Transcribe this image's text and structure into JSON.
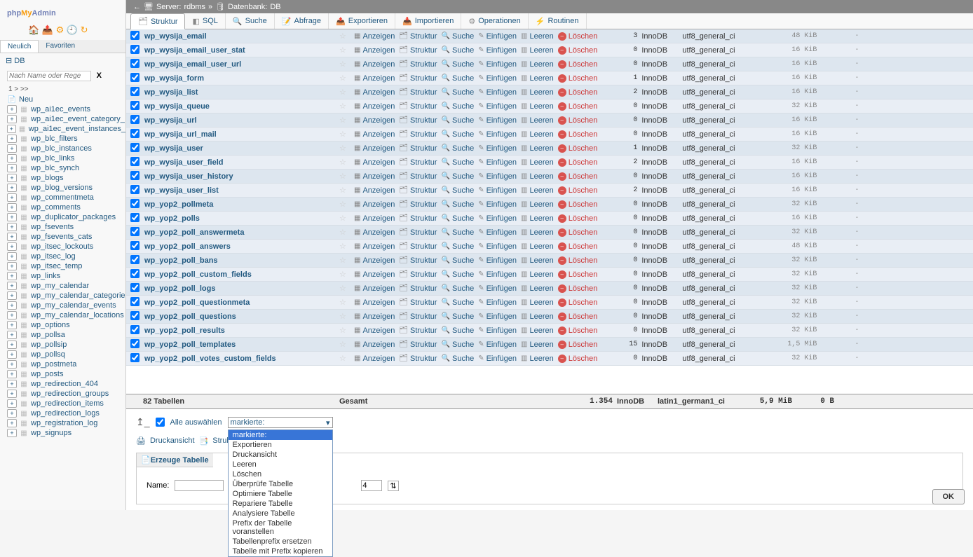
{
  "logo": {
    "php": "php",
    "my": "My",
    "admin": "Admin"
  },
  "sidebar_tabs": {
    "recent": "Neulich",
    "fav": "Favoriten"
  },
  "db_label": "DB",
  "filter_placeholder": "Nach Name oder Regex filtern",
  "paging": "1   > >>",
  "neu_label": "Neu",
  "tree": [
    "wp_ai1ec_events",
    "wp_ai1ec_event_category_",
    "wp_ai1ec_event_instances_",
    "wp_blc_filters",
    "wp_blc_instances",
    "wp_blc_links",
    "wp_blc_synch",
    "wp_blogs",
    "wp_blog_versions",
    "wp_commentmeta",
    "wp_comments",
    "wp_duplicator_packages",
    "wp_fsevents",
    "wp_fsevents_cats",
    "wp_itsec_lockouts",
    "wp_itsec_log",
    "wp_itsec_temp",
    "wp_links",
    "wp_my_calendar",
    "wp_my_calendar_categorie",
    "wp_my_calendar_events",
    "wp_my_calendar_locations",
    "wp_options",
    "wp_pollsa",
    "wp_pollsip",
    "wp_pollsq",
    "wp_postmeta",
    "wp_posts",
    "wp_redirection_404",
    "wp_redirection_groups",
    "wp_redirection_items",
    "wp_redirection_logs",
    "wp_registration_log",
    "wp_signups"
  ],
  "breadcrumb": {
    "server_label": "Server:",
    "server": "rdbms",
    "db_label": "Datenbank:",
    "db": "DB"
  },
  "tabs": [
    {
      "icon": "🗂",
      "label": "Struktur",
      "active": true
    },
    {
      "icon": "◧",
      "label": "SQL"
    },
    {
      "icon": "🔍",
      "label": "Suche"
    },
    {
      "icon": "📝",
      "label": "Abfrage"
    },
    {
      "icon": "📤",
      "label": "Exportieren"
    },
    {
      "icon": "📥",
      "label": "Importieren"
    },
    {
      "icon": "⚙",
      "label": "Operationen"
    },
    {
      "icon": "⚡",
      "label": "Routinen"
    }
  ],
  "row_actions": {
    "browse": "Anzeigen",
    "structure": "Struktur",
    "search": "Suche",
    "insert": "Einfügen",
    "empty": "Leeren",
    "drop": "Löschen"
  },
  "cols": {
    "engine": "InnoDB",
    "collation": "utf8_general_ci"
  },
  "tables": [
    {
      "name": "wp_wysija_email",
      "rows": 3,
      "size": "48 KiB"
    },
    {
      "name": "wp_wysija_email_user_stat",
      "rows": 0,
      "size": "16 KiB"
    },
    {
      "name": "wp_wysija_email_user_url",
      "rows": 0,
      "size": "16 KiB"
    },
    {
      "name": "wp_wysija_form",
      "rows": 1,
      "size": "16 KiB"
    },
    {
      "name": "wp_wysija_list",
      "rows": 2,
      "size": "16 KiB"
    },
    {
      "name": "wp_wysija_queue",
      "rows": 0,
      "size": "32 KiB"
    },
    {
      "name": "wp_wysija_url",
      "rows": 0,
      "size": "16 KiB"
    },
    {
      "name": "wp_wysija_url_mail",
      "rows": 0,
      "size": "16 KiB"
    },
    {
      "name": "wp_wysija_user",
      "rows": 1,
      "size": "32 KiB"
    },
    {
      "name": "wp_wysija_user_field",
      "rows": 2,
      "size": "16 KiB"
    },
    {
      "name": "wp_wysija_user_history",
      "rows": 0,
      "size": "16 KiB"
    },
    {
      "name": "wp_wysija_user_list",
      "rows": 2,
      "size": "16 KiB"
    },
    {
      "name": "wp_yop2_pollmeta",
      "rows": 0,
      "size": "32 KiB"
    },
    {
      "name": "wp_yop2_polls",
      "rows": 0,
      "size": "16 KiB"
    },
    {
      "name": "wp_yop2_poll_answermeta",
      "rows": 0,
      "size": "32 KiB"
    },
    {
      "name": "wp_yop2_poll_answers",
      "rows": 0,
      "size": "48 KiB"
    },
    {
      "name": "wp_yop2_poll_bans",
      "rows": 0,
      "size": "32 KiB"
    },
    {
      "name": "wp_yop2_poll_custom_fields",
      "rows": 0,
      "size": "32 KiB"
    },
    {
      "name": "wp_yop2_poll_logs",
      "rows": 0,
      "size": "32 KiB"
    },
    {
      "name": "wp_yop2_poll_questionmeta",
      "rows": 0,
      "size": "32 KiB"
    },
    {
      "name": "wp_yop2_poll_questions",
      "rows": 0,
      "size": "32 KiB"
    },
    {
      "name": "wp_yop2_poll_results",
      "rows": 0,
      "size": "32 KiB"
    },
    {
      "name": "wp_yop2_poll_templates",
      "rows": 15,
      "size": "1,5 MiB"
    },
    {
      "name": "wp_yop2_poll_votes_custom_fields",
      "rows": 0,
      "size": "32 KiB"
    }
  ],
  "summary": {
    "count": "82 Tabellen",
    "total_label": "Gesamt",
    "rows": "1.354",
    "engine": "InnoDB",
    "collation": "latin1_german1_ci",
    "size": "5,9 MiB",
    "overhead": "0 B"
  },
  "checkall": {
    "label": "Alle auswählen",
    "selected": "markierte:"
  },
  "dropdown_options": [
    "markierte:",
    "Exportieren",
    "Druckansicht",
    "Leeren",
    "Löschen",
    "Überprüfe Tabelle",
    "Optimiere Tabelle",
    "Repariere Tabelle",
    "Analysiere Tabelle",
    "Prefix der Tabelle voranstellen",
    "Tabellenprefix ersetzen",
    "Tabelle mit Prefix kopieren"
  ],
  "printline": {
    "print": "Druckansicht",
    "dict": "Strukturverz"
  },
  "create": {
    "legend": "Erzeuge Tabelle",
    "name_label": "Name:",
    "cols_value": "4"
  },
  "ok": "OK",
  "dash": "-"
}
